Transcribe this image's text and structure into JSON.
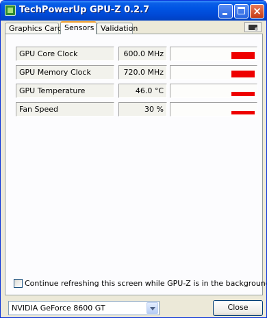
{
  "window": {
    "title": "TechPowerUp GPU-Z 0.2.7"
  },
  "title_buttons": {
    "minimize": "",
    "maximize": "",
    "close": "×"
  },
  "tabs": [
    {
      "label": "Graphics Card",
      "active": false
    },
    {
      "label": "Sensors",
      "active": true
    },
    {
      "label": "Validation",
      "active": false
    }
  ],
  "toolbar": {
    "icon": "camera-icon"
  },
  "sensors": [
    {
      "name": "GPU Core Clock",
      "value": "600.0 MHz",
      "level": 0.6
    },
    {
      "name": "GPU Memory Clock",
      "value": "720.0 MHz",
      "level": 0.6
    },
    {
      "name": "GPU Temperature",
      "value": "46.0 °C",
      "level": 0.35
    },
    {
      "name": "Fan Speed",
      "value": "30 %",
      "level": 0.3
    }
  ],
  "refresh": {
    "checked": false,
    "label": "Continue refreshing this screen while GPU-Z is in the background"
  },
  "gpu_select": {
    "value": "NVIDIA GeForce 8600 GT"
  },
  "close_button": {
    "label": "Close"
  },
  "colors": {
    "graph_bar": "#ee0000",
    "titlebar": "#0054e3"
  }
}
